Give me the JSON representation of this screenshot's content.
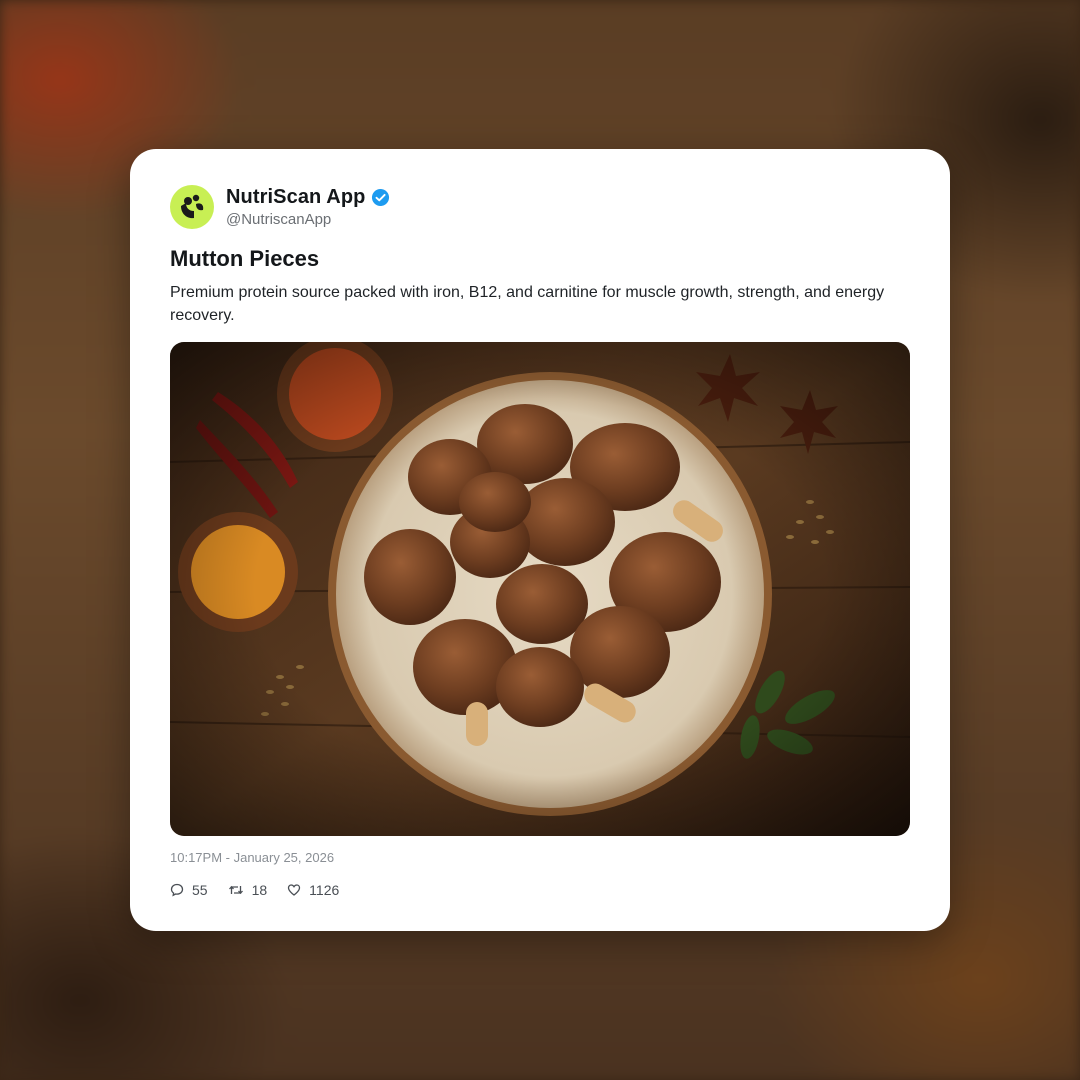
{
  "account": {
    "name": "NutriScan App",
    "handle": "@NutriscanApp",
    "verified_icon": "verified-badge-icon",
    "avatar_color": "#c8ef54",
    "badge_color": "#1d9bf0"
  },
  "post": {
    "title": "Mutton Pieces",
    "description": "Premium protein source packed with iron, B12, and carnitine for muscle growth, strength, and energy recovery.",
    "image_alt": "Plate of cooked mutton pieces with spices on a wooden table",
    "timestamp": "10:17PM - January 25, 2026"
  },
  "stats": {
    "replies": "55",
    "reposts": "18",
    "likes": "1126",
    "reply_icon": "comment-icon",
    "repost_icon": "repost-icon",
    "like_icon": "heart-icon"
  }
}
